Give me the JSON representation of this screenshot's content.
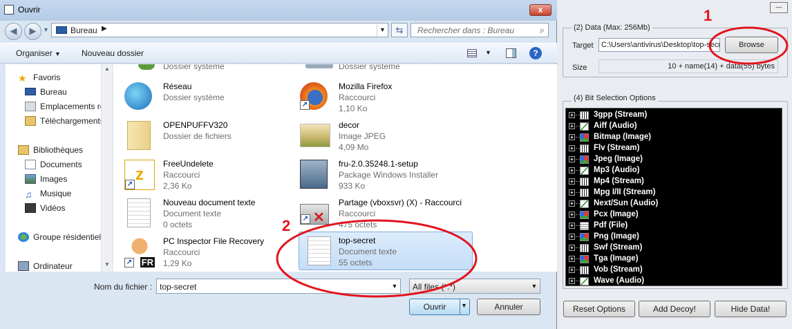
{
  "dialog": {
    "title": "Ouvrir",
    "close_label": "x",
    "address": "Bureau",
    "search_placeholder": "Rechercher dans : Bureau",
    "toolbar": {
      "organize": "Organiser",
      "new_folder": "Nouveau dossier"
    },
    "nav": {
      "favorites": "Favoris",
      "fav_items": [
        "Bureau",
        "Emplacements ré",
        "Téléchargements"
      ],
      "libraries": "Bibliothèques",
      "lib_items": [
        "Documents",
        "Images",
        "Musique",
        "Vidéos"
      ],
      "homegroup": "Groupe résidentiel",
      "computer": "Ordinateur"
    },
    "top_partial": [
      "Dossier système",
      "Dossier système"
    ],
    "files_left": [
      {
        "name": "Réseau",
        "type": "Dossier système",
        "size": ""
      },
      {
        "name": "OPENPUFFV320",
        "type": "Dossier de fichiers",
        "size": ""
      },
      {
        "name": "FreeUndelete",
        "type": "Raccourci",
        "size": "2,36 Ko"
      },
      {
        "name": "Nouveau document texte",
        "type": "Document texte",
        "size": "0 octets"
      },
      {
        "name": "PC Inspector File Recovery",
        "type": "Raccourci",
        "size": "1,29 Ko"
      }
    ],
    "files_right": [
      {
        "name": "Mozilla Firefox",
        "type": "Raccourci",
        "size": "1,10 Ko"
      },
      {
        "name": "decor",
        "type": "Image JPEG",
        "size": "4,09 Mo"
      },
      {
        "name": "fru-2.0.35248.1-setup",
        "type": "Package Windows Installer",
        "size": "933 Ko"
      },
      {
        "name": "Partage (vboxsvr) (X) - Raccourci",
        "type": "Raccourci",
        "size": "475 octets"
      },
      {
        "name": "top-secret",
        "type": "Document texte",
        "size": "55 octets"
      }
    ],
    "filename_label": "Nom du fichier :",
    "filename_value": "top-secret",
    "filetype_value": "All files (*.*)",
    "open_label": "Ouvrir",
    "cancel_label": "Annuler"
  },
  "annotations": {
    "one": "1",
    "two": "2"
  },
  "panel": {
    "top_button": "—",
    "data_group": "(2)  Data (Max: 256Mb)",
    "target_label": "Target",
    "target_value": "C:\\Users\\antivirus\\Desktop\\top-secr",
    "browse_label": "Browse",
    "size_label": "Size",
    "size_value": "10 + name(14) + data(55) bytes",
    "bits_group": "(4)  Bit Selection Options",
    "carriers": [
      "3gpp (Stream)",
      "Aiff (Audio)",
      "Bitmap (Image)",
      "Flv (Stream)",
      "Jpeg (Image)",
      "Mp3 (Audio)",
      "Mp4 (Stream)",
      "Mpg I/II (Stream)",
      "Next/Sun (Audio)",
      "Pcx (Image)",
      "Pdf (File)",
      "Png (Image)",
      "Swf (Stream)",
      "Tga (Image)",
      "Vob (Stream)",
      "Wave (Audio)"
    ],
    "reset_label": "Reset Options",
    "decoy_label": "Add Decoy!",
    "hide_label": "Hide Data!"
  },
  "colors": {
    "annotation": "#e2141e",
    "selection": "#c4ddf7",
    "tree_bg": "#000000"
  }
}
